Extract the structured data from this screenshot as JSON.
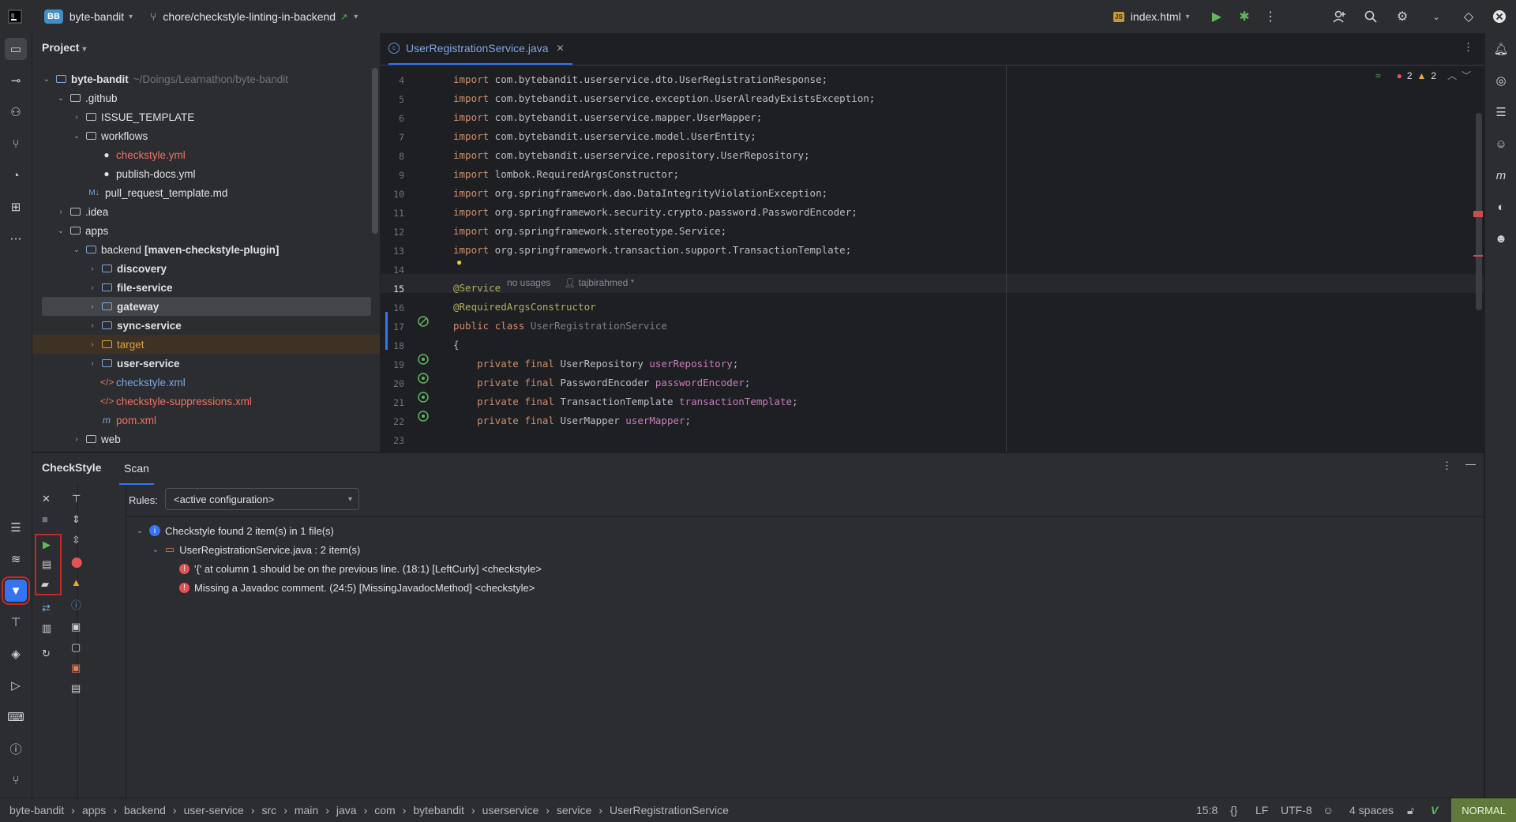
{
  "titlebar": {
    "project_badge": "BB",
    "project_name": "byte-bandit",
    "branch": "chore/checkstyle-linting-in-backend",
    "run_config": "index.html"
  },
  "project_panel": {
    "title": "Project",
    "root_name": "byte-bandit",
    "root_path": "~/Doings/Learnathon/byte-bandit",
    "items": [
      {
        "label": ".github"
      },
      {
        "label": "ISSUE_TEMPLATE"
      },
      {
        "label": "workflows"
      },
      {
        "label": "checkstyle.yml"
      },
      {
        "label": "publish-docs.yml"
      },
      {
        "label": "pull_request_template.md"
      },
      {
        "label": ".idea"
      },
      {
        "label": "apps"
      },
      {
        "label": "backend",
        "suffix": "[maven-checkstyle-plugin]"
      },
      {
        "label": "discovery"
      },
      {
        "label": "file-service"
      },
      {
        "label": "gateway"
      },
      {
        "label": "sync-service"
      },
      {
        "label": "target"
      },
      {
        "label": "user-service"
      },
      {
        "label": "checkstyle.xml"
      },
      {
        "label": "checkstyle-suppressions.xml"
      },
      {
        "label": "pom.xml"
      },
      {
        "label": "web"
      }
    ]
  },
  "editor": {
    "tab_label": "UserRegistrationService.java",
    "error_count": "2",
    "warning_count": "2",
    "lines": [
      {
        "n": "4",
        "t": "import com.bytebandit.userservice.dto.UserRegistrationResponse;"
      },
      {
        "n": "5",
        "t": "import com.bytebandit.userservice.exception.UserAlreadyExistsException;"
      },
      {
        "n": "6",
        "t": "import com.bytebandit.userservice.mapper.UserMapper;"
      },
      {
        "n": "7",
        "t": "import com.bytebandit.userservice.model.UserEntity;"
      },
      {
        "n": "8",
        "t": "import com.bytebandit.userservice.repository.UserRepository;"
      },
      {
        "n": "9",
        "t": "import lombok.RequiredArgsConstructor;"
      },
      {
        "n": "10",
        "t": "import org.springframework.dao.DataIntegrityViolationException;"
      },
      {
        "n": "11",
        "t": "import org.springframework.security.crypto.password.PasswordEncoder;"
      },
      {
        "n": "12",
        "t": "import org.springframework.stereotype.Service;"
      },
      {
        "n": "13",
        "t": "import org.springframework.transaction.support.TransactionTemplate;"
      },
      {
        "n": "14",
        "t": ""
      },
      {
        "n": "15",
        "t": "@Service"
      },
      {
        "n": "16",
        "t": "@RequiredArgsConstructor"
      },
      {
        "n": "17",
        "t": "public class UserRegistrationService"
      },
      {
        "n": "18",
        "t": "{"
      },
      {
        "n": "19",
        "t": "    private final UserRepository userRepository;"
      },
      {
        "n": "20",
        "t": "    private final PasswordEncoder passwordEncoder;"
      },
      {
        "n": "21",
        "t": "    private final TransactionTemplate transactionTemplate;"
      },
      {
        "n": "22",
        "t": "    private final UserMapper userMapper;"
      },
      {
        "n": "23",
        "t": ""
      }
    ],
    "inlay_usages": "no usages",
    "inlay_author": "tajbirahmed *"
  },
  "bottom_panel": {
    "tab_checkstyle": "CheckStyle",
    "tab_scan": "Scan",
    "rules_label": "Rules:",
    "rules_value": "<active configuration>",
    "summary": "Checkstyle found 2 item(s) in 1 file(s)",
    "file_node": "UserRegistrationService.java : 2 item(s)",
    "issues": [
      "'{' at column 1 should be on the previous line. (18:1) [LeftCurly] <checkstyle>",
      "Missing a Javadoc comment. (24:5) [MissingJavadocMethod] <checkstyle>"
    ]
  },
  "statusbar": {
    "breadcrumbs": [
      "byte-bandit",
      "apps",
      "backend",
      "user-service",
      "src",
      "main",
      "java",
      "com",
      "bytebandit",
      "userservice",
      "service",
      "UserRegistrationService"
    ],
    "position": "15:8",
    "line_sep": "LF",
    "encoding": "UTF-8",
    "indent": "4 spaces",
    "mode": "NORMAL"
  }
}
